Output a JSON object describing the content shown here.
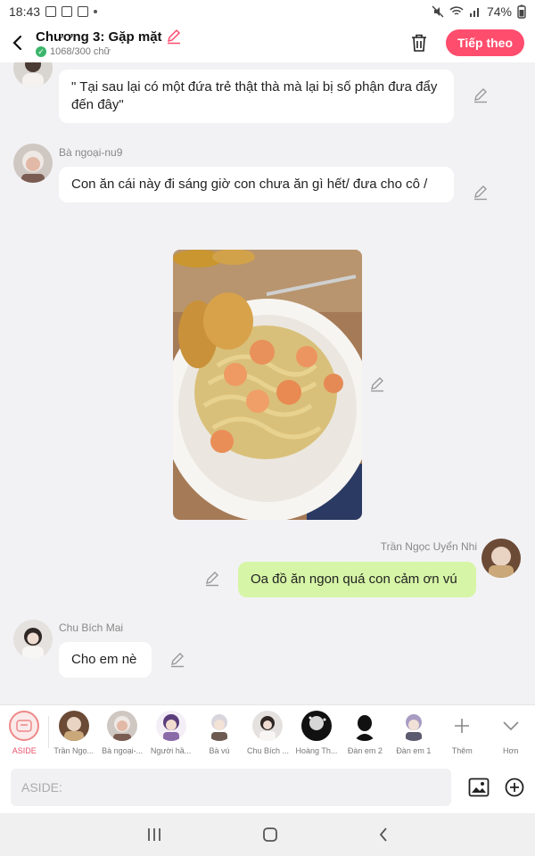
{
  "status": {
    "time": "18:43",
    "battery": "74%"
  },
  "header": {
    "title": "Chương 3: Gặp mặt",
    "word_count": "1068/300 chữ",
    "next_label": "Tiếp theo"
  },
  "messages": [
    {
      "text": "\" Tại sau lại có một đứa trẻ thật thà mà lại bị số phận đưa đẩy đến đây\""
    },
    {
      "name": "Bà ngoại-nu9",
      "text": "Con ăn cái này đi sáng giờ con chưa ăn gì hết/ đưa cho cô /"
    },
    {
      "name": "Trần Ngọc Uyển Nhi",
      "text": "Oa đồ ăn ngon quá con cảm ơn vú"
    },
    {
      "name": "Chu Bích Mai",
      "text": "Cho em nè"
    }
  ],
  "characters": [
    {
      "label": "ASIDE"
    },
    {
      "label": "Trần Ngọ..."
    },
    {
      "label": "Bà ngoại-..."
    },
    {
      "label": "Người hầ..."
    },
    {
      "label": "Bà vú"
    },
    {
      "label": "Chu Bích ..."
    },
    {
      "label": "Hoàng Th..."
    },
    {
      "label": "Đàn em 2"
    },
    {
      "label": "Đàn em 1"
    },
    {
      "label": "Thêm"
    },
    {
      "label": "Hơn"
    }
  ],
  "input": {
    "placeholder": "ASIDE:"
  },
  "colors": {
    "accent": "#ff4d6d",
    "my_bubble": "#d6f5a6"
  }
}
